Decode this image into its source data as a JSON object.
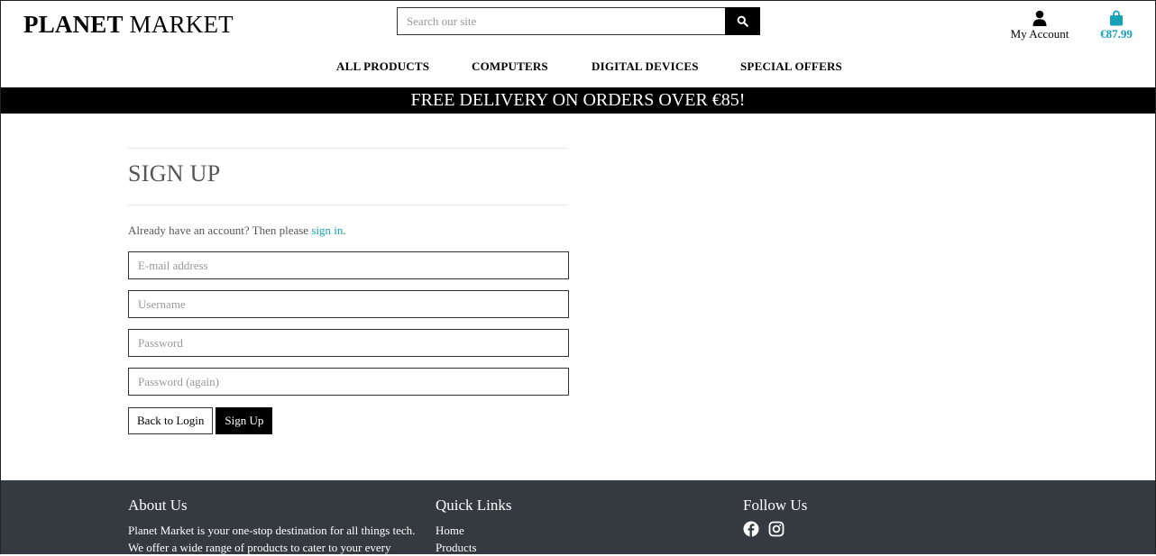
{
  "brand": {
    "bold": "PLANET",
    "rest": "MARKET"
  },
  "search": {
    "placeholder": "Search our site",
    "icon": "search-icon"
  },
  "account": {
    "label": "My Account",
    "icon": "user-icon"
  },
  "bag": {
    "total": "€87.99",
    "icon": "shopping-bag-icon",
    "color": "#17a2b8"
  },
  "nav": {
    "items": [
      {
        "label": "ALL PRODUCTS"
      },
      {
        "label": "COMPUTERS"
      },
      {
        "label": "DIGITAL DEVICES"
      },
      {
        "label": "SPECIAL OFFERS"
      }
    ]
  },
  "banner": {
    "text": "FREE DELIVERY ON ORDERS OVER €85!"
  },
  "signup": {
    "title": "SIGN UP",
    "intro_prefix": "Already have an account? Then please ",
    "intro_link": "sign in",
    "intro_suffix": ".",
    "fields": {
      "email": {
        "placeholder": "E-mail address",
        "value": ""
      },
      "username": {
        "placeholder": "Username",
        "value": ""
      },
      "password": {
        "placeholder": "Password",
        "value": ""
      },
      "password2": {
        "placeholder": "Password (again)",
        "value": ""
      }
    },
    "back_label": "Back to Login",
    "submit_label": "Sign Up"
  },
  "footer": {
    "about": {
      "heading": "About Us",
      "text": "Planet Market is your one-stop destination for all things tech. We offer a wide range of products to cater to your every"
    },
    "quick_links": {
      "heading": "Quick Links",
      "items": [
        {
          "label": "Home"
        },
        {
          "label": "Products"
        }
      ]
    },
    "follow": {
      "heading": "Follow Us",
      "icons": [
        "facebook-icon",
        "instagram-icon"
      ]
    }
  },
  "colors": {
    "accent": "#17a2b8",
    "banner_bg": "#000000",
    "footer_bg": "#343a40"
  }
}
